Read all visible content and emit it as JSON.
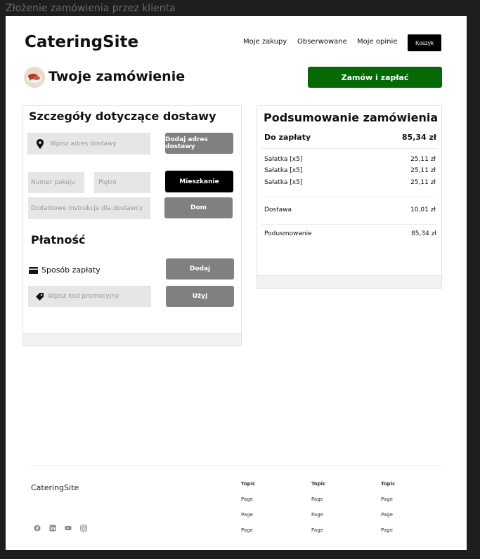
{
  "frame_title": "Złożenie zamówienia przez klienta",
  "header": {
    "brand": "CateringSite",
    "nav": [
      "Moje zakupy",
      "Obserwowane",
      "Moje opinie"
    ],
    "cart_label": "Koszyk"
  },
  "page": {
    "title": "Twoje zamówienie",
    "order_button": "Zamów i zapłać"
  },
  "delivery": {
    "title": "Szczegóły dotyczące dostawy",
    "address_placeholder": "Wpisz adres dostawy",
    "add_address_button": "Dodaj adres dostawy",
    "room_placeholder": "Numer pokoju",
    "floor_placeholder": "Piętro",
    "apartment_button": "Mieszkanie",
    "instructions_placeholder": "Dodatkowe instrukcje dla dostawcy",
    "house_button": "Dom"
  },
  "payment": {
    "title": "Płatność",
    "method_label": "Sposób zapłaty",
    "add_button": "Dodaj",
    "promo_placeholder": "Wpisz kod promocyjny",
    "use_button": "Użyj"
  },
  "summary": {
    "title": "Podsumowanie zamówienia",
    "to_pay_label": "Do zapłaty",
    "to_pay_value": "85,34 zł",
    "items": [
      {
        "name": "Sałatka [x5]",
        "price": "25,11 zł"
      },
      {
        "name": "Sałatka [x5]",
        "price": "25,11 zł"
      },
      {
        "name": "Sałatka [x5]",
        "price": "25,11 zł"
      }
    ],
    "delivery_label": "Dostawa",
    "delivery_value": "10,01 zł",
    "total_label": "Podusmowanie",
    "total_value": "85,34 zł"
  },
  "footer": {
    "brand": "CateringSite",
    "columns": [
      {
        "topic": "Topic",
        "pages": [
          "Page",
          "Page",
          "Page"
        ]
      },
      {
        "topic": "Topic",
        "pages": [
          "Page",
          "Page",
          "Page"
        ]
      },
      {
        "topic": "Topic",
        "pages": [
          "Page",
          "Page",
          "Page"
        ]
      }
    ],
    "social_icons": [
      "facebook-icon",
      "linkedin-icon",
      "youtube-icon",
      "instagram-icon"
    ]
  },
  "colors": {
    "primary_green": "#056a05",
    "button_gray": "#808080",
    "field_gray": "#e6e6e6"
  }
}
